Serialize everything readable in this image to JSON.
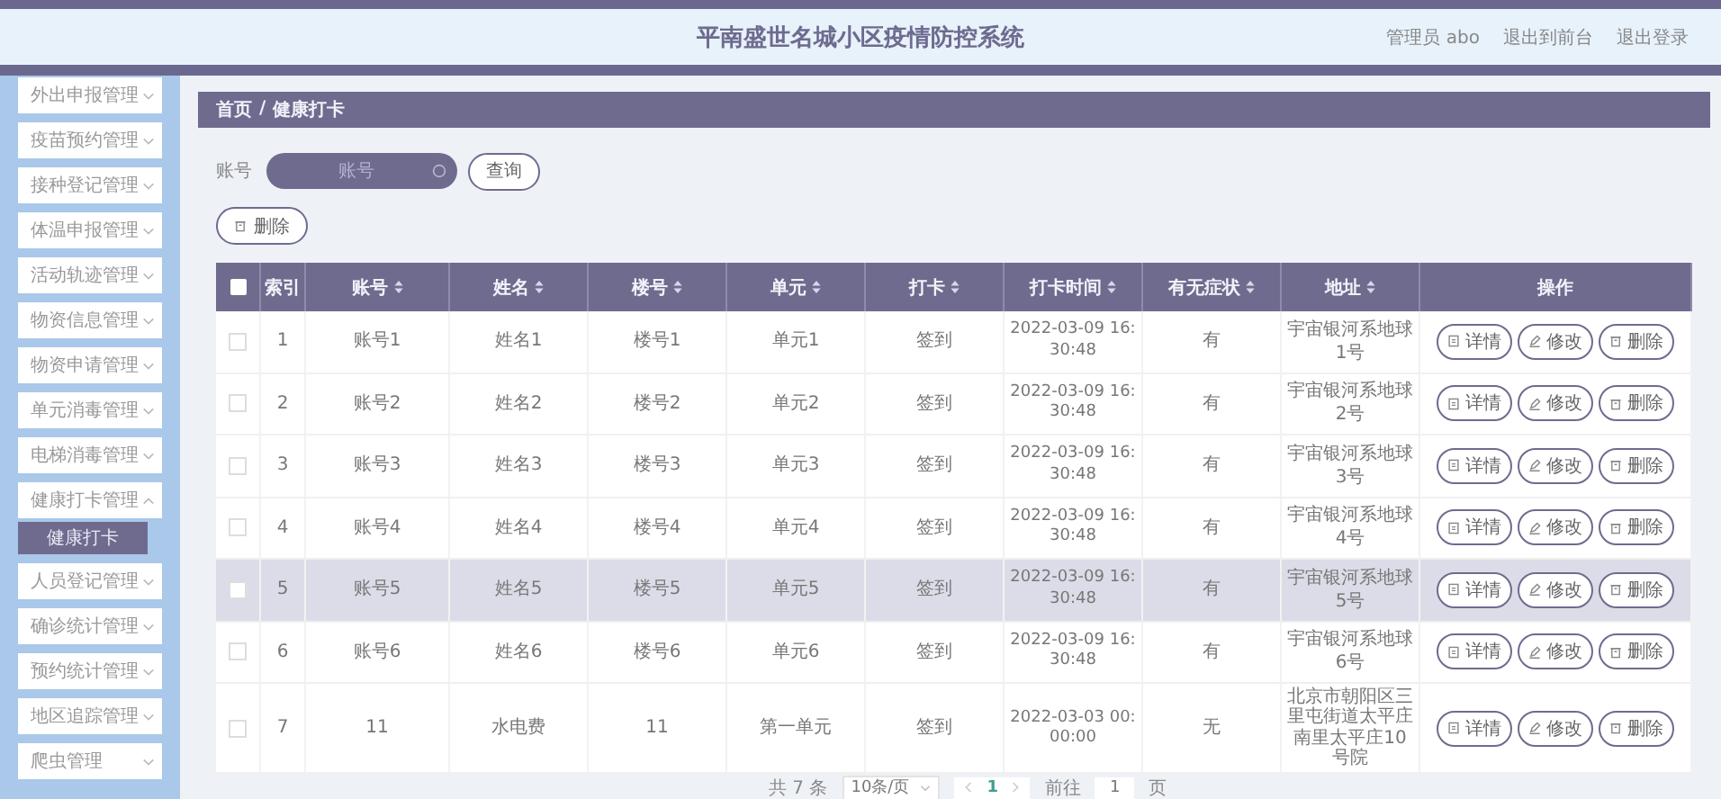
{
  "header": {
    "title": "平南盛世名城小区疫情防控系统",
    "user": "管理员 abo",
    "links": [
      "退出到前台",
      "退出登录"
    ]
  },
  "sidebar": {
    "items": [
      {
        "label": "外出申报管理",
        "expanded": false
      },
      {
        "label": "疫苗预约管理",
        "expanded": false
      },
      {
        "label": "接种登记管理",
        "expanded": false
      },
      {
        "label": "体温申报管理",
        "expanded": false
      },
      {
        "label": "活动轨迹管理",
        "expanded": false
      },
      {
        "label": "物资信息管理",
        "expanded": false
      },
      {
        "label": "物资申请管理",
        "expanded": false
      },
      {
        "label": "单元消毒管理",
        "expanded": false
      },
      {
        "label": "电梯消毒管理",
        "expanded": false
      },
      {
        "label": "健康打卡管理",
        "expanded": true,
        "children": [
          {
            "label": "健康打卡",
            "selected": true
          }
        ]
      },
      {
        "label": "人员登记管理",
        "expanded": false
      },
      {
        "label": "确诊统计管理",
        "expanded": false
      },
      {
        "label": "预约统计管理",
        "expanded": false
      },
      {
        "label": "地区追踪管理",
        "expanded": false
      },
      {
        "label": "爬虫管理",
        "expanded": false
      }
    ]
  },
  "breadcrumb": {
    "items": [
      "首页",
      "健康打卡"
    ],
    "separator": "/"
  },
  "search": {
    "label": "账号",
    "placeholder": "账号",
    "button": "查询"
  },
  "toolbar": {
    "delete_button": "删除"
  },
  "table": {
    "select_all_checked": false,
    "columns": [
      {
        "kind": "text",
        "label": "索引",
        "sortable": false
      },
      {
        "kind": "text",
        "label": "账号",
        "sortable": true
      },
      {
        "kind": "text",
        "label": "姓名",
        "sortable": true
      },
      {
        "kind": "text",
        "label": "楼号",
        "sortable": true
      },
      {
        "kind": "text",
        "label": "单元",
        "sortable": true
      },
      {
        "kind": "text",
        "label": "打卡",
        "sortable": true
      },
      {
        "kind": "text",
        "label": "打卡时间",
        "sortable": true
      },
      {
        "kind": "text",
        "label": "有无症状",
        "sortable": true
      },
      {
        "kind": "text",
        "label": "地址",
        "sortable": true
      },
      {
        "kind": "actions",
        "label": "操作",
        "sortable": false
      }
    ],
    "rows": [
      {
        "checked": false,
        "highlighted": false,
        "cells": [
          "1",
          "账号1",
          "姓名1",
          "楼号1",
          "单元1",
          "签到",
          "2022-03-09 16:30:48",
          "有",
          "宇宙银河系地球1号"
        ],
        "actions": [
          "详情",
          "修改",
          "删除"
        ]
      },
      {
        "checked": false,
        "highlighted": false,
        "cells": [
          "2",
          "账号2",
          "姓名2",
          "楼号2",
          "单元2",
          "签到",
          "2022-03-09 16:30:48",
          "有",
          "宇宙银河系地球2号"
        ],
        "actions": [
          "详情",
          "修改",
          "删除"
        ]
      },
      {
        "checked": false,
        "highlighted": false,
        "cells": [
          "3",
          "账号3",
          "姓名3",
          "楼号3",
          "单元3",
          "签到",
          "2022-03-09 16:30:48",
          "有",
          "宇宙银河系地球3号"
        ],
        "actions": [
          "详情",
          "修改",
          "删除"
        ]
      },
      {
        "checked": false,
        "highlighted": false,
        "cells": [
          "4",
          "账号4",
          "姓名4",
          "楼号4",
          "单元4",
          "签到",
          "2022-03-09 16:30:48",
          "有",
          "宇宙银河系地球4号"
        ],
        "actions": [
          "详情",
          "修改",
          "删除"
        ]
      },
      {
        "checked": false,
        "highlighted": true,
        "cells": [
          "5",
          "账号5",
          "姓名5",
          "楼号5",
          "单元5",
          "签到",
          "2022-03-09 16:30:48",
          "有",
          "宇宙银河系地球5号"
        ],
        "actions": [
          "详情",
          "修改",
          "删除"
        ]
      },
      {
        "checked": false,
        "highlighted": false,
        "cells": [
          "6",
          "账号6",
          "姓名6",
          "楼号6",
          "单元6",
          "签到",
          "2022-03-09 16:30:48",
          "有",
          "宇宙银河系地球6号"
        ],
        "actions": [
          "详情",
          "修改",
          "删除"
        ]
      },
      {
        "checked": false,
        "highlighted": false,
        "cells": [
          "7",
          "11",
          "水电费",
          "11",
          "第一单元",
          "签到",
          "2022-03-03 00:00:00",
          "无",
          "北京市朝阳区三里屯街道太平庄南里太平庄10号院"
        ],
        "actions": [
          "详情",
          "修改",
          "删除"
        ]
      }
    ]
  },
  "pagination": {
    "total": "共 7 条",
    "page_size": "10条/页",
    "pages": [
      {
        "label": "1",
        "selected": true
      }
    ],
    "goto_label": "前往",
    "goto_value": "1",
    "goto_suffix": "页"
  }
}
